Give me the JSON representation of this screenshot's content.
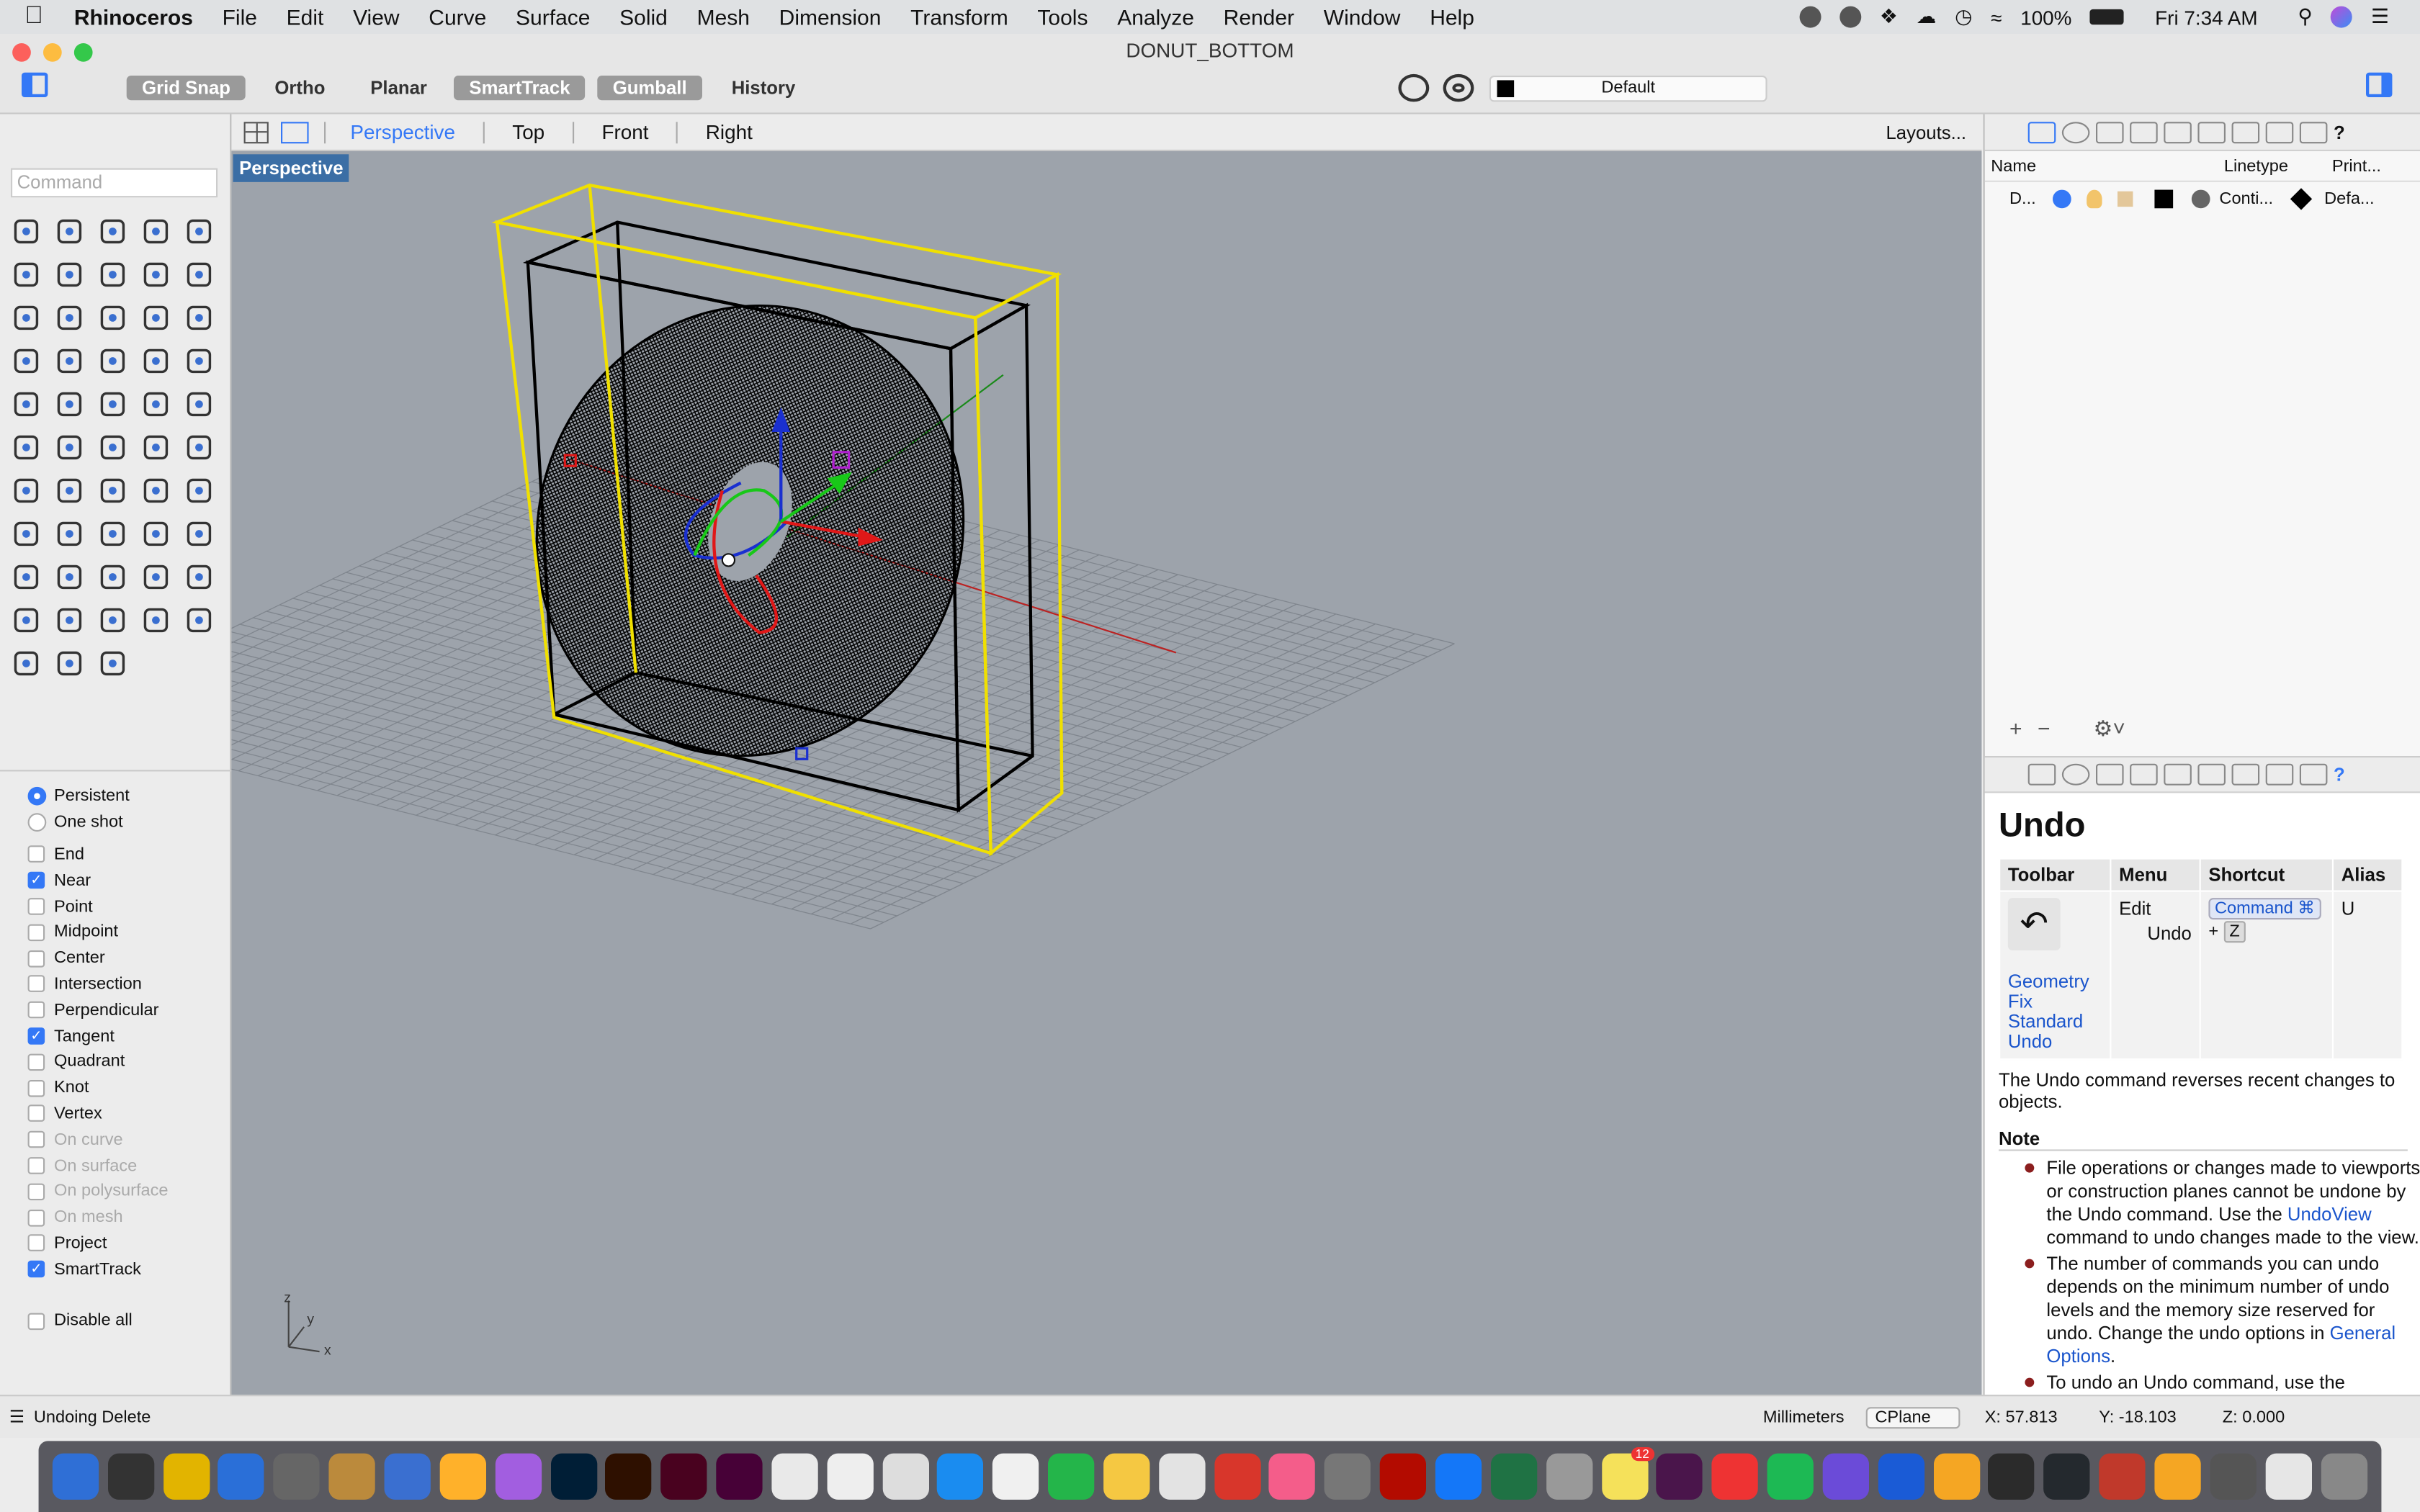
{
  "menubar": {
    "app": "Rhinoceros",
    "items": [
      "File",
      "Edit",
      "View",
      "Curve",
      "Surface",
      "Solid",
      "Mesh",
      "Dimension",
      "Transform",
      "Tools",
      "Analyze",
      "Render",
      "Window",
      "Help"
    ],
    "battery": "100%",
    "clock": "Fri 7:34 AM"
  },
  "window": {
    "title": "DONUT_BOTTOM"
  },
  "toolbar": {
    "buttons": [
      {
        "label": "Grid Snap",
        "on": true
      },
      {
        "label": "Ortho",
        "on": false
      },
      {
        "label": "Planar",
        "on": false
      },
      {
        "label": "SmartTrack",
        "on": true
      },
      {
        "label": "Gumball",
        "on": true
      },
      {
        "label": "History",
        "on": false
      }
    ],
    "layer": "Default",
    "layer_color": "#000000"
  },
  "command": {
    "placeholder": "Command"
  },
  "tool_icons": [
    "select-arrow-icon",
    "point-icon",
    "polyline-icon",
    "curve-icon",
    "circle-icon",
    "ellipse-icon",
    "arc-icon",
    "rectangle-icon",
    "polygon-icon",
    "fillet-curve-icon",
    "surface-pt-icon",
    "extrude-surface-icon",
    "box-icon",
    "sphere-icon",
    "cylinder-icon",
    "patch-icon",
    "gear-icon",
    "explode-icon",
    "trim-icon",
    "split-icon",
    "boolean-icon",
    "group-icon",
    "rebuild-icon",
    "join-icon",
    "text-icon",
    "move-icon",
    "array-icon",
    "scale-icon",
    "solid-tools-icon",
    "dimension-icon",
    "grid-array-icon",
    "align-icon",
    "fold-icon",
    "check-icon",
    "cage-icon",
    "analyze-icon",
    "zoom-icon",
    "zoom-window-icon",
    "zoom-extents-icon",
    "zoom-selected-icon",
    "rotate-view-icon",
    "car-icon",
    "mesh-icon",
    "layer-tools-icon",
    "light-icon",
    "lock-icon",
    "material-icon",
    "color-wheel-icon",
    "globe-icon",
    "render-icon",
    "render-sphere-icon",
    "camera-icon",
    "transform-icon"
  ],
  "osnap": {
    "modes": [
      {
        "label": "Persistent",
        "on": true
      },
      {
        "label": "One shot",
        "on": false
      }
    ],
    "items": [
      {
        "label": "End",
        "on": false,
        "dis": false
      },
      {
        "label": "Near",
        "on": true,
        "dis": false
      },
      {
        "label": "Point",
        "on": false,
        "dis": false
      },
      {
        "label": "Midpoint",
        "on": false,
        "dis": false
      },
      {
        "label": "Center",
        "on": false,
        "dis": false
      },
      {
        "label": "Intersection",
        "on": false,
        "dis": false
      },
      {
        "label": "Perpendicular",
        "on": false,
        "dis": false
      },
      {
        "label": "Tangent",
        "on": true,
        "dis": false
      },
      {
        "label": "Quadrant",
        "on": false,
        "dis": false
      },
      {
        "label": "Knot",
        "on": false,
        "dis": false
      },
      {
        "label": "Vertex",
        "on": false,
        "dis": false
      },
      {
        "label": "On curve",
        "on": false,
        "dis": true
      },
      {
        "label": "On surface",
        "on": false,
        "dis": true
      },
      {
        "label": "On polysurface",
        "on": false,
        "dis": true
      },
      {
        "label": "On mesh",
        "on": false,
        "dis": true
      },
      {
        "label": "Project",
        "on": false,
        "dis": false
      },
      {
        "label": "SmartTrack",
        "on": true,
        "dis": false
      }
    ],
    "disable_all": "Disable all"
  },
  "viewport": {
    "tabs": [
      "Perspective",
      "Top",
      "Front",
      "Right"
    ],
    "active": "Perspective",
    "layouts": "Layouts...",
    "label": "Perspective",
    "axis": {
      "z": "z",
      "y": "y",
      "x": "x"
    }
  },
  "layers": {
    "columns": [
      "Name",
      "Linetype",
      "Print..."
    ],
    "row": {
      "name": "D...",
      "linetype": "Conti...",
      "print": "Defa..."
    }
  },
  "help": {
    "title": "Undo",
    "headers": [
      "Toolbar",
      "Menu",
      "Shortcut",
      "Alias"
    ],
    "menu": [
      "Edit",
      "Undo"
    ],
    "shortcut_key": "Command ⌘",
    "shortcut_plus": "+",
    "shortcut_z": "Z",
    "alias": "U",
    "toolbar_links": [
      "Geometry Fix",
      "Standard",
      "Undo"
    ],
    "description": "The Undo command reverses recent changes to objects.",
    "note_title": "Note",
    "note1_a": "File operations or changes made to viewports or construction planes cannot be undone by the Undo command. Use the ",
    "note1_link": "UndoView",
    "note1_b": " command to undo changes made to the view.",
    "note2_a": "The number of commands you can undo depends on the minimum number of undo levels and the memory size reserved for undo. Change the undo options in ",
    "note2_link": "General Options",
    "note2_b": ".",
    "note3": "To undo an Undo command, use the"
  },
  "status": {
    "message": "Undoing Delete",
    "units": "Millimeters",
    "cplane": "CPlane",
    "x": "X: 57.813",
    "y": "Y: -18.103",
    "z": "Z: 0.000"
  },
  "dock": {
    "badge": "12"
  }
}
